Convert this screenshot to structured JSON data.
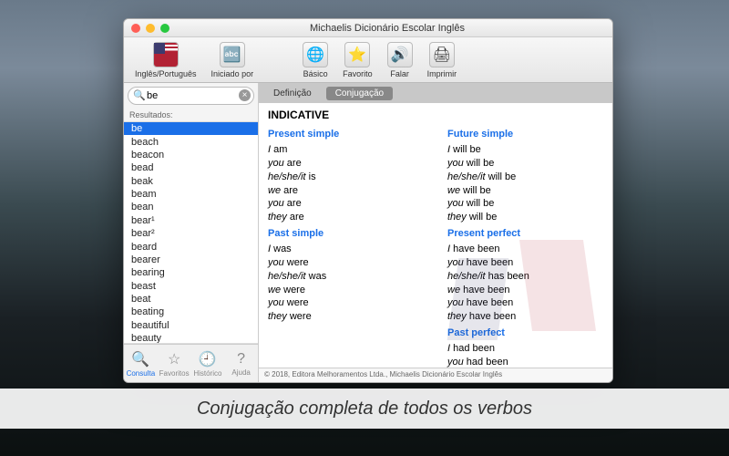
{
  "window": {
    "title": "Michaelis Dicionário Escolar Inglês"
  },
  "toolbar": {
    "items": [
      {
        "label": "Inglês/Português"
      },
      {
        "label": "Iniciado por"
      },
      {
        "label": "Básico"
      },
      {
        "label": "Favorito"
      },
      {
        "label": "Falar"
      },
      {
        "label": "Imprimir"
      }
    ]
  },
  "search": {
    "value": "be",
    "placeholder": ""
  },
  "results_header": "Resultados:",
  "results": [
    "be",
    "beach",
    "beacon",
    "bead",
    "beak",
    "beam",
    "bean",
    "bear¹",
    "bear²",
    "beard",
    "bearer",
    "bearing",
    "beast",
    "beat",
    "beating",
    "beautiful",
    "beauty"
  ],
  "bottom_tabs": [
    {
      "label": "Consulta",
      "icon": "🔍"
    },
    {
      "label": "Favoritos",
      "icon": "☆"
    },
    {
      "label": "Histórico",
      "icon": "🕘"
    },
    {
      "label": "Ajuda",
      "icon": "?"
    }
  ],
  "content_tabs": [
    {
      "label": "Definição"
    },
    {
      "label": "Conjugação"
    }
  ],
  "conjugation": {
    "heading": "INDICATIVE",
    "left": [
      {
        "title": "Present simple",
        "lines": [
          [
            "I",
            "am"
          ],
          [
            "you",
            "are"
          ],
          [
            "he/she/it",
            "is"
          ],
          [
            "we",
            "are"
          ],
          [
            "you",
            "are"
          ],
          [
            "they",
            "are"
          ]
        ]
      },
      {
        "title": "Past simple",
        "lines": [
          [
            "I",
            "was"
          ],
          [
            "you",
            "were"
          ],
          [
            "he/she/it",
            "was"
          ],
          [
            "we",
            "were"
          ],
          [
            "you",
            "were"
          ],
          [
            "they",
            "were"
          ]
        ]
      }
    ],
    "right": [
      {
        "title": "Future simple",
        "lines": [
          [
            "I",
            "will be"
          ],
          [
            "you",
            "will be"
          ],
          [
            "he/she/it",
            "will be"
          ],
          [
            "we",
            "will be"
          ],
          [
            "you",
            "will be"
          ],
          [
            "they",
            "will be"
          ]
        ]
      },
      {
        "title": "Present perfect",
        "lines": [
          [
            "I",
            "have been"
          ],
          [
            "you",
            "have been"
          ],
          [
            "he/she/it",
            "has been"
          ],
          [
            "we",
            "have been"
          ],
          [
            "you",
            "have been"
          ],
          [
            "they",
            "have been"
          ]
        ]
      },
      {
        "title": "Past perfect",
        "lines": [
          [
            "I",
            "had been"
          ],
          [
            "you",
            "had been"
          ]
        ]
      }
    ]
  },
  "footer": "© 2018, Editora Melhoramentos Ltda., Michaelis Dicionário Escolar Inglês",
  "caption": "Conjugação completa de todos os verbos"
}
